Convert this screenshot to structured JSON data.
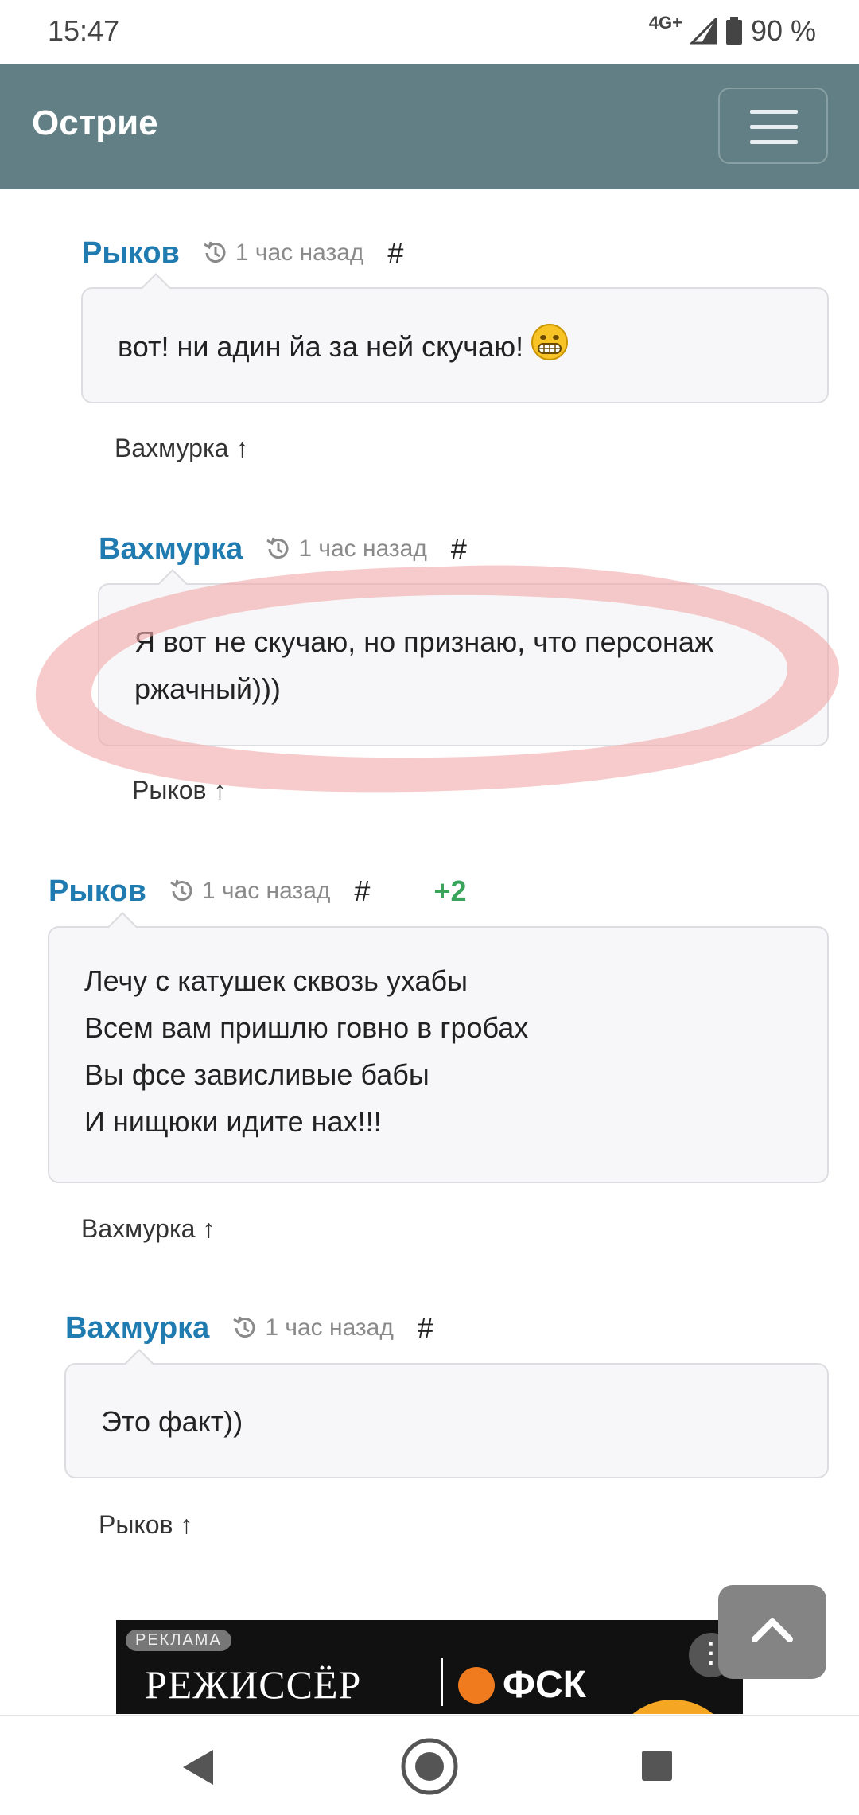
{
  "status_bar": {
    "time": "15:47",
    "network": "4G+",
    "battery": "90 %"
  },
  "navbar": {
    "brand": "Острие"
  },
  "comments": [
    {
      "author": "Рыков",
      "time": "1 час назад",
      "anchor": "#",
      "lines": [
        "вот! ни адин йа за ней скучаю!"
      ],
      "emoji": "grinning-face-emoji",
      "reply_to": "Вахмурка ↑"
    },
    {
      "author": "Вахмурка",
      "time": "1 час назад",
      "anchor": "#",
      "lines": [
        "Я вот не скучаю, но признаю, что персонаж",
        "ржачный)))"
      ],
      "reply_to": "Рыков ↑"
    },
    {
      "author": "Рыков",
      "time": "1 час назад",
      "anchor": "#",
      "score": "+2",
      "lines": [
        "Лечу с катушек сквозь ухабы",
        "Всем вам пришлю говно в гробах",
        "Вы фсе зависливые бабы",
        "И нищюки идите нах!!!"
      ],
      "reply_to": "Вахмурка ↑"
    },
    {
      "author": "Вахмурка",
      "time": "1 час назад",
      "anchor": "#",
      "lines": [
        "Это факт))"
      ],
      "reply_to": "Рыков ↑"
    }
  ],
  "ad": {
    "tag": "РЕКЛАМА",
    "text": "РЕЖИССЁР",
    "brand": "ФСК",
    "more": "⋮"
  },
  "colors": {
    "navbar": "#617f84",
    "author": "#1f7bb0",
    "score": "#3aa35c",
    "highlight": "#f2a8a8"
  }
}
